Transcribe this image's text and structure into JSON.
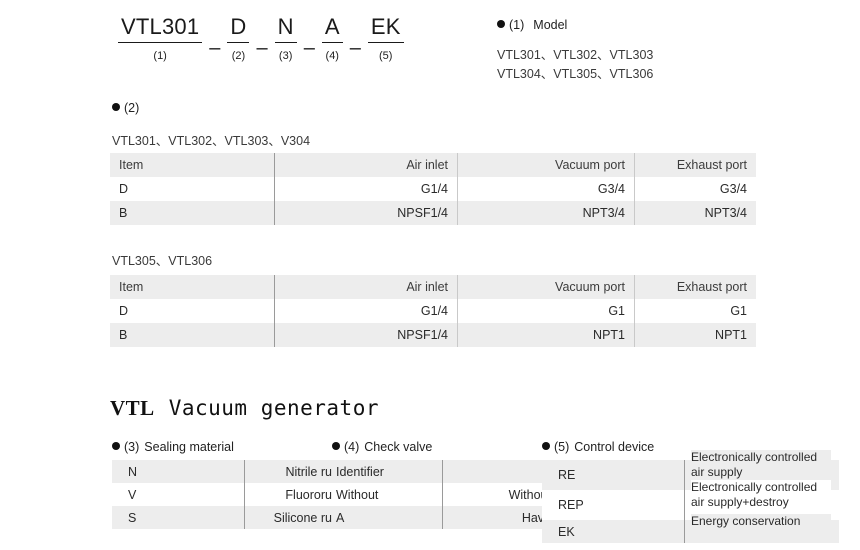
{
  "code": {
    "segments": [
      {
        "text": "VTL301",
        "index": "(1)"
      },
      {
        "text": "D",
        "index": "(2)"
      },
      {
        "text": "N",
        "index": "(3)"
      },
      {
        "text": "A",
        "index": "(4)"
      },
      {
        "text": "EK",
        "index": "(5)"
      }
    ],
    "separator": "–"
  },
  "model_note": {
    "bullet_index": "(1)",
    "title": "Model",
    "line1": "VTL301、VTL302、VTL303",
    "line2": "VTL304、VTL305、VTL306"
  },
  "section2": {
    "bullet_index": "(2)",
    "title": "",
    "group1_label": "VTL301、VTL302、VTL303、V304",
    "group2_label": "VTL305、VTL306",
    "headers": [
      "Item",
      "Air inlet",
      "Vacuum port",
      "Exhaust port"
    ],
    "table1_rows": [
      [
        "D",
        "G1/4",
        "G3/4",
        "G3/4"
      ],
      [
        "B",
        "NPSF1/4",
        "NPT3/4",
        "NPT3/4"
      ]
    ],
    "table2_rows": [
      [
        "D",
        "G1/4",
        "G1",
        "G1"
      ],
      [
        "B",
        "NPSF1/4",
        "NPT1",
        "NPT1"
      ]
    ]
  },
  "big_title": {
    "prefix": "VTL",
    "rest": "Vacuum generator"
  },
  "option3": {
    "bullet_index": "(3)",
    "title": "Sealing material",
    "rows": [
      [
        "N",
        "Nitrile rubber"
      ],
      [
        "V",
        "Fluororubber"
      ],
      [
        "S",
        "Silicone rubber"
      ]
    ]
  },
  "option4": {
    "bullet_index": "(4)",
    "title": "Check valve",
    "rows": [
      [
        "Identifier",
        ""
      ],
      [
        "Without",
        "Without"
      ],
      [
        "A",
        "Have"
      ]
    ]
  },
  "option5": {
    "bullet_index": "(5)",
    "title": "Control device",
    "rows": [
      {
        "code": "RE",
        "line1": "Electronically controlled",
        "line2": "air supply"
      },
      {
        "code": "REP",
        "line1": "Electronically controlled",
        "line2": "air supply+destroy"
      },
      {
        "code": "EK",
        "line1": "Energy conservation",
        "line2": ""
      }
    ]
  }
}
